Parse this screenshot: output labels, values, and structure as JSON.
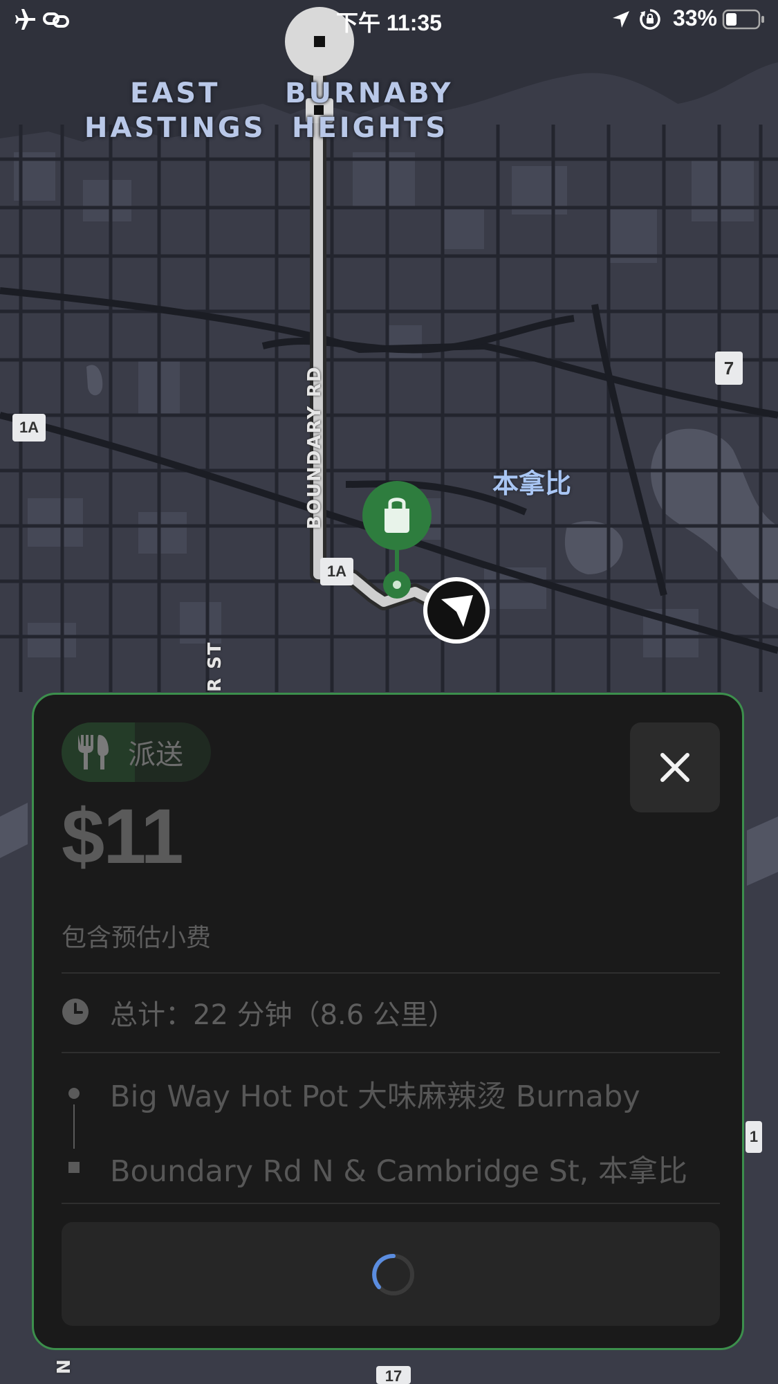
{
  "status_bar": {
    "time": "下午 11:35",
    "battery_percent": "33%",
    "battery_level": 0.33,
    "icons": [
      "airplane-mode-icon",
      "link-icon",
      "location-arrow-icon",
      "rotation-lock-icon",
      "battery-icon"
    ]
  },
  "map": {
    "areas": [
      "EAST",
      "HASTINGS",
      "BURNABY",
      "HEIGHTS"
    ],
    "city": "本拿比",
    "road_name": "BOUNDARY RD",
    "road_name_partial": "R ST",
    "edge_letter": "N",
    "shields": [
      "1A",
      "1A",
      "7",
      "1",
      "17"
    ],
    "icons": [
      "pickup-bag-icon",
      "current-location-arrow-icon",
      "route-start-square-icon"
    ]
  },
  "offer_card": {
    "type_label": "派送",
    "type_icon": "fork-knife-icon",
    "price": "$11",
    "price_note": "包含预估小费",
    "total_label": "总计：22 分钟（8.6 公里）",
    "stops": [
      "Big Way Hot Pot 大味麻辣烫 Burnaby",
      "Boundary Rd N & Cambridge St, 本拿比"
    ],
    "close_icon": "close-icon",
    "loading_icon": "loading-spinner-icon"
  },
  "colors": {
    "map_bg": "#3a3c48",
    "accent_green": "#2e7d3e",
    "card_bg": "#1a1a1a",
    "card_border": "#3c8f4c",
    "spinner_blue": "#5b8de0"
  }
}
